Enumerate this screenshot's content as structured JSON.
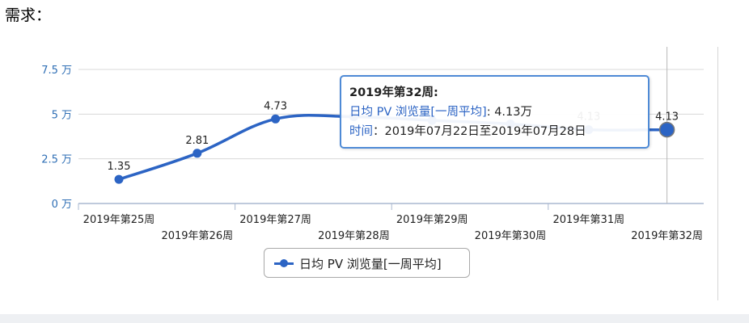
{
  "heading": "需求：",
  "chart_data": {
    "type": "line",
    "categories": [
      "2019年第25周",
      "2019年第26周",
      "2019年第27周",
      "2019年第28周",
      "2019年第29周",
      "2019年第30周",
      "2019年第31周",
      "2019年第32周"
    ],
    "series": [
      {
        "name": "日均 PV 浏览量[一周平均]",
        "values": [
          1.35,
          2.81,
          4.73,
          4.85,
          4.65,
          4.45,
          4.13,
          4.13
        ],
        "data_labels": [
          "1.35",
          "2.81",
          "4.73",
          "",
          "",
          "",
          "4.13",
          "4.13"
        ],
        "color": "#2c64c4"
      }
    ],
    "yticks": [
      "0 万",
      "2.5 万",
      "5 万",
      "7.5 万"
    ],
    "ytick_values": [
      0,
      2.5,
      5,
      7.5
    ],
    "ylim": [
      0,
      7.5
    ],
    "legend_position": "bottom",
    "grid": true,
    "highlighted_index": 7
  },
  "tooltip": {
    "title": "2019年第32周:",
    "series_label": "日均 PV 浏览量[一周平均]",
    "series_value": ": 4.13万",
    "time_label": "时间",
    "time_value": "：2019年07月22日至2019年07月28日"
  },
  "legend": {
    "label": "日均 PV 浏览量[一周平均]"
  }
}
